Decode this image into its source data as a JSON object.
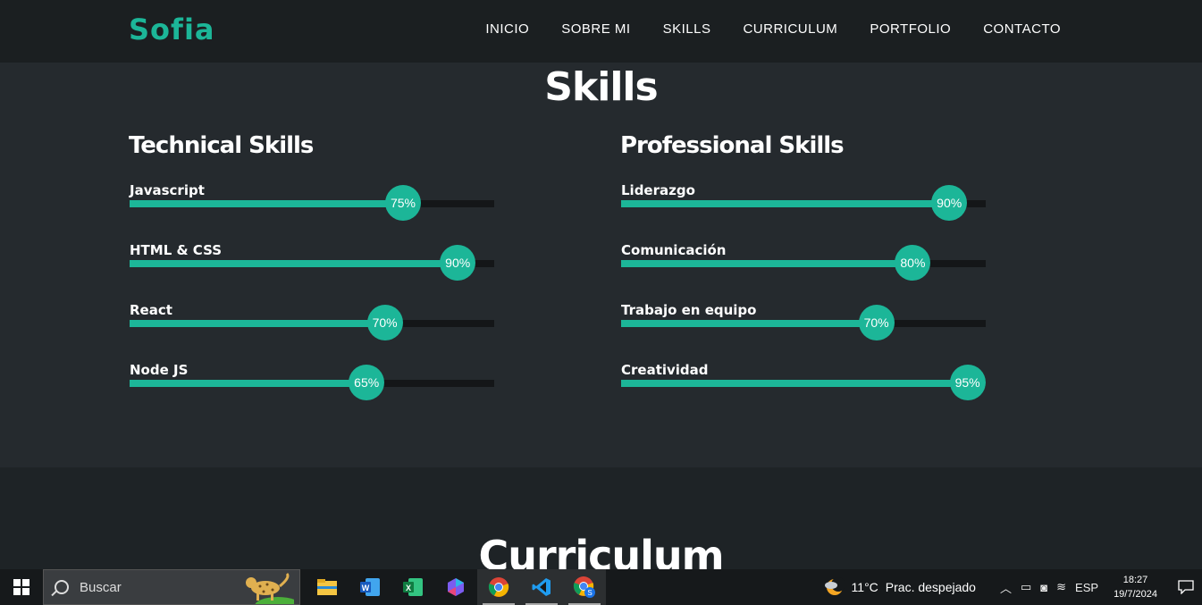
{
  "header": {
    "logo": "Sofia",
    "nav": [
      "INICIO",
      "SOBRE MI",
      "SKILLS",
      "CURRICULUM",
      "PORTFOLIO",
      "CONTACTO"
    ]
  },
  "skills": {
    "title": "Skills",
    "technical": {
      "title": "Technical Skills",
      "items": [
        {
          "name": "Javascript",
          "percent": 75,
          "label": "75%"
        },
        {
          "name": "HTML & CSS",
          "percent": 90,
          "label": "90%"
        },
        {
          "name": "React",
          "percent": 70,
          "label": "70%"
        },
        {
          "name": "Node JS",
          "percent": 65,
          "label": "65%"
        }
      ]
    },
    "professional": {
      "title": "Professional Skills",
      "items": [
        {
          "name": "Liderazgo",
          "percent": 90,
          "label": "90%"
        },
        {
          "name": "Comunicación",
          "percent": 80,
          "label": "80%"
        },
        {
          "name": "Trabajo en equipo",
          "percent": 70,
          "label": "70%"
        },
        {
          "name": "Creatividad",
          "percent": 95,
          "label": "95%"
        }
      ]
    }
  },
  "curriculum": {
    "title": "Curriculum"
  },
  "taskbar": {
    "search_placeholder": "Buscar",
    "apps": [
      "file-explorer-icon",
      "word-icon",
      "excel-icon",
      "copilot-icon",
      "chrome-icon",
      "vscode-icon",
      "chrome-profile-icon"
    ],
    "weather_temp": "11°C",
    "weather_desc": "Prac. despejado",
    "language": "ESP",
    "time": "18:27",
    "date": "19/7/2024"
  },
  "colors": {
    "accent": "#1cb698",
    "header_bg": "#1b1f21",
    "section_bg": "#252a2e",
    "track": "#141618"
  }
}
